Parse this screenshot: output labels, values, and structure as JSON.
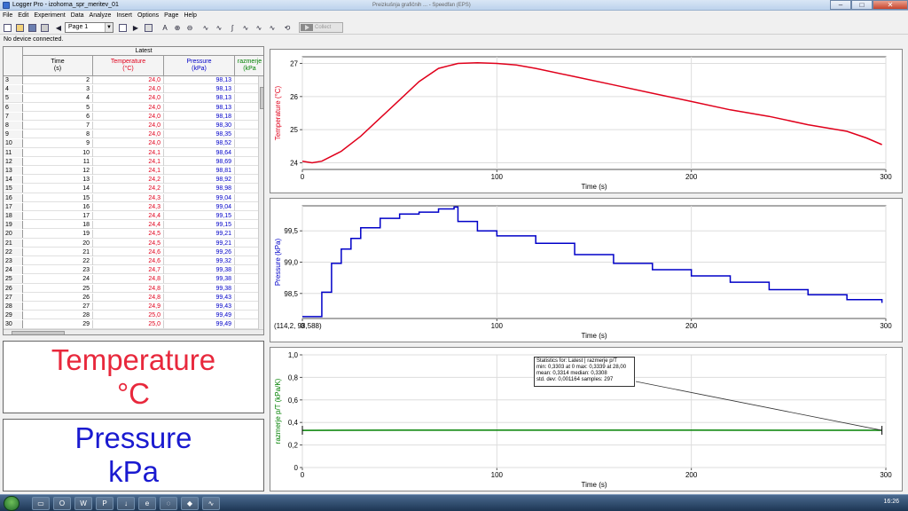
{
  "window": {
    "title": "Logger Pro - izohorna_spr_meritev_01",
    "caption": "Preizkušnja grafičnih ... - Speedfan (EPS)",
    "minimize": "–",
    "maximize": "□",
    "close": "✕"
  },
  "menu": [
    "File",
    "Edit",
    "Experiment",
    "Data",
    "Analyze",
    "Insert",
    "Options",
    "Page",
    "Help"
  ],
  "toolbar": {
    "page_select": "Page 1",
    "collect_label": "Collect",
    "icons": [
      "new-file-icon",
      "open-folder-icon",
      "save-icon",
      "print-icon",
      "back-icon",
      "page-icon",
      "next-page-icon",
      "grid-icon",
      "trash-icon",
      "autoscale-icon",
      "zoom-in-icon",
      "zoom-out-icon",
      "examine-icon",
      "tangent-icon",
      "integral-icon",
      "stats-icon",
      "fit-icon",
      "curve-fit-icon",
      "replay-icon"
    ]
  },
  "status": "No device connected.",
  "table": {
    "dataset": "Latest",
    "columns": [
      {
        "name": "Time",
        "unit": "(s)"
      },
      {
        "name": "Temperature",
        "unit": "(°C)"
      },
      {
        "name": "Pressure",
        "unit": "(kPa)"
      },
      {
        "name": "razmerje",
        "unit": "(kPa"
      }
    ],
    "rows": [
      [
        "3",
        "2",
        "24,0",
        "98,13"
      ],
      [
        "4",
        "3",
        "24,0",
        "98,13"
      ],
      [
        "5",
        "4",
        "24,0",
        "98,13"
      ],
      [
        "6",
        "5",
        "24,0",
        "98,13"
      ],
      [
        "7",
        "6",
        "24,0",
        "98,18"
      ],
      [
        "8",
        "7",
        "24,0",
        "98,30"
      ],
      [
        "9",
        "8",
        "24,0",
        "98,35"
      ],
      [
        "10",
        "9",
        "24,0",
        "98,52"
      ],
      [
        "11",
        "10",
        "24,1",
        "98,64"
      ],
      [
        "12",
        "11",
        "24,1",
        "98,69"
      ],
      [
        "13",
        "12",
        "24,1",
        "98,81"
      ],
      [
        "14",
        "13",
        "24,2",
        "98,92"
      ],
      [
        "15",
        "14",
        "24,2",
        "98,98"
      ],
      [
        "16",
        "15",
        "24,3",
        "99,04"
      ],
      [
        "17",
        "16",
        "24,3",
        "99,04"
      ],
      [
        "18",
        "17",
        "24,4",
        "99,15"
      ],
      [
        "19",
        "18",
        "24,4",
        "99,15"
      ],
      [
        "20",
        "19",
        "24,5",
        "99,21"
      ],
      [
        "21",
        "20",
        "24,5",
        "99,21"
      ],
      [
        "22",
        "21",
        "24,6",
        "99,26"
      ],
      [
        "23",
        "22",
        "24,6",
        "99,32"
      ],
      [
        "24",
        "23",
        "24,7",
        "99,38"
      ],
      [
        "25",
        "24",
        "24,8",
        "99,38"
      ],
      [
        "26",
        "25",
        "24,8",
        "99,38"
      ],
      [
        "27",
        "26",
        "24,8",
        "99,43"
      ],
      [
        "28",
        "27",
        "24,9",
        "99,43"
      ],
      [
        "29",
        "28",
        "25,0",
        "99,49"
      ],
      [
        "30",
        "29",
        "25,0",
        "99,49"
      ]
    ]
  },
  "meters": {
    "temperature": {
      "name": "Temperature",
      "unit": "°C"
    },
    "pressure": {
      "name": "Pressure",
      "unit": "kPa"
    }
  },
  "chart_data": [
    {
      "type": "line",
      "xlabel": "Time (s)",
      "ylabel": "Temperature (°C)",
      "xlim": [
        0,
        300
      ],
      "ylim": [
        23.8,
        27.2
      ],
      "xticks": [
        "0",
        "100",
        "200",
        "300"
      ],
      "yticks": [
        "24",
        "25",
        "26",
        "27"
      ],
      "color": "#e0001b",
      "x": [
        0,
        5,
        10,
        20,
        30,
        40,
        50,
        60,
        70,
        80,
        90,
        100,
        110,
        120,
        140,
        160,
        180,
        200,
        220,
        240,
        260,
        280,
        290,
        298
      ],
      "y": [
        24.05,
        24.0,
        24.05,
        24.35,
        24.8,
        25.35,
        25.9,
        26.45,
        26.85,
        27.0,
        27.02,
        27.0,
        26.95,
        26.85,
        26.6,
        26.35,
        26.1,
        25.85,
        25.6,
        25.4,
        25.15,
        24.95,
        24.75,
        24.55
      ]
    },
    {
      "type": "line",
      "xlabel": "Time (s)",
      "ylabel": "Pressure (kPa)",
      "xlim": [
        0,
        300
      ],
      "ylim": [
        98.1,
        99.9
      ],
      "xticks": [
        "0",
        "100",
        "200",
        "300"
      ],
      "yticks": [
        "98,5",
        "99,0",
        "99,5"
      ],
      "color": "#0000c8",
      "readout": "(114,2, 98,588)",
      "x": [
        0,
        5,
        10,
        15,
        20,
        25,
        30,
        40,
        50,
        60,
        70,
        78,
        80,
        90,
        100,
        120,
        140,
        160,
        180,
        200,
        220,
        240,
        260,
        280,
        298
      ],
      "y": [
        98.13,
        98.13,
        98.52,
        98.98,
        99.21,
        99.38,
        99.55,
        99.7,
        99.77,
        99.8,
        99.85,
        99.88,
        99.65,
        99.5,
        99.42,
        99.3,
        99.12,
        98.98,
        98.88,
        98.78,
        98.68,
        98.56,
        98.48,
        98.4,
        98.35
      ]
    },
    {
      "type": "line",
      "xlabel": "Time (s)",
      "ylabel": "razmerje p/T (kPa/K)",
      "xlim": [
        0,
        300
      ],
      "ylim": [
        0,
        1.0
      ],
      "xticks": [
        "0",
        "100",
        "200",
        "300"
      ],
      "yticks": [
        "0",
        "0,2",
        "0,4",
        "0,6",
        "0,8",
        "1,0"
      ],
      "color": "#008000",
      "x": [
        0,
        50,
        100,
        150,
        200,
        250,
        298
      ],
      "y": [
        0.3303,
        0.3316,
        0.3318,
        0.3314,
        0.3312,
        0.331,
        0.3308
      ],
      "stats": [
        "Statistics for: Latest | razmerje p/T",
        "min: 0,3303 at 0 max: 0,3339 at 28,00",
        "mean: 0,3314 median: 0,3308",
        "std. dev: 0,001164 samples: 297"
      ]
    }
  ],
  "taskbar": {
    "clock": "16:26"
  }
}
